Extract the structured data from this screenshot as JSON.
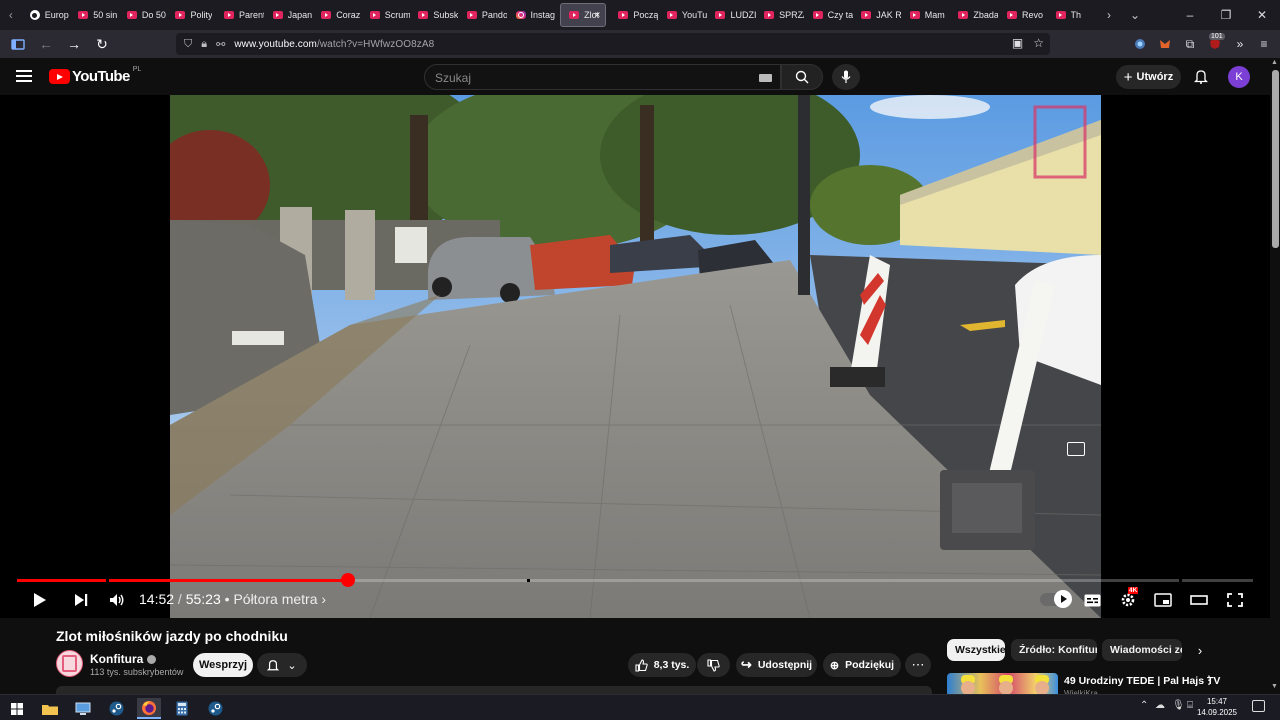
{
  "browser": {
    "tabs": [
      {
        "label": "Europ",
        "icon": "euro-site-icon"
      },
      {
        "label": "50 sin",
        "icon": "youtube-icon"
      },
      {
        "label": "Do 50",
        "icon": "youtube-icon"
      },
      {
        "label": "Polity",
        "icon": "youtube-icon"
      },
      {
        "label": "Parent",
        "icon": "youtube-icon"
      },
      {
        "label": "Japan",
        "icon": "youtube-icon"
      },
      {
        "label": "Coraz",
        "icon": "youtube-icon"
      },
      {
        "label": "Scrum",
        "icon": "youtube-icon"
      },
      {
        "label": "Subsk",
        "icon": "youtube-icon"
      },
      {
        "label": "Pando",
        "icon": "youtube-icon"
      },
      {
        "label": "Instag",
        "icon": "instagram-icon"
      },
      {
        "label": "Zlot",
        "icon": "youtube-icon",
        "active": true
      },
      {
        "label": "Począ",
        "icon": "youtube-icon"
      },
      {
        "label": "YouTu",
        "icon": "youtube-icon"
      },
      {
        "label": "LUDZI",
        "icon": "youtube-icon"
      },
      {
        "label": "SPRZ/",
        "icon": "youtube-icon"
      },
      {
        "label": "Czy ta",
        "icon": "youtube-icon"
      },
      {
        "label": "JAK R",
        "icon": "youtube-icon"
      },
      {
        "label": "Mam",
        "icon": "youtube-icon"
      },
      {
        "label": "Zbada",
        "icon": "youtube-icon"
      },
      {
        "label": "Revo",
        "icon": "youtube-icon"
      },
      {
        "label": "Th",
        "icon": "youtube-icon"
      }
    ],
    "active_tab_close": "×",
    "url_host": "www.youtube.com",
    "url_path": "/watch?v=HWfwzOO8zA8",
    "extension_badge": "101"
  },
  "youtube": {
    "logo_text": "YouTube",
    "country_code": "PL",
    "search_placeholder": "Szukaj",
    "create_label": "Utwórz",
    "avatar_letter": "K"
  },
  "player": {
    "time_current": "14:52",
    "time_separator": " / ",
    "time_total": "55:23",
    "chapter": " • Półtora metra ›",
    "progress_fraction": 0.268,
    "hd_badge": "4K"
  },
  "video": {
    "title": "Zlot miłośników jazdy po chodniku",
    "channel_name": "Konfitura",
    "subscribers": "113 tys. subskrybentów",
    "support_label": "Wesprzyj",
    "likes": "8,3 tys.",
    "share_label": "Udostępnij",
    "thanks_label": "Podziękuj",
    "more_label": "⋯"
  },
  "sidebar": {
    "chips": [
      "Wszystkie",
      "Źródło: Konfitura",
      "Wiadomości ze ś"
    ],
    "recommendation_title": "49 Urodziny TEDE | Pal Hajs TV",
    "recommendation_channel": "WielkiKra"
  },
  "taskbar": {
    "time": "15:47",
    "date": "14.09.2025"
  }
}
